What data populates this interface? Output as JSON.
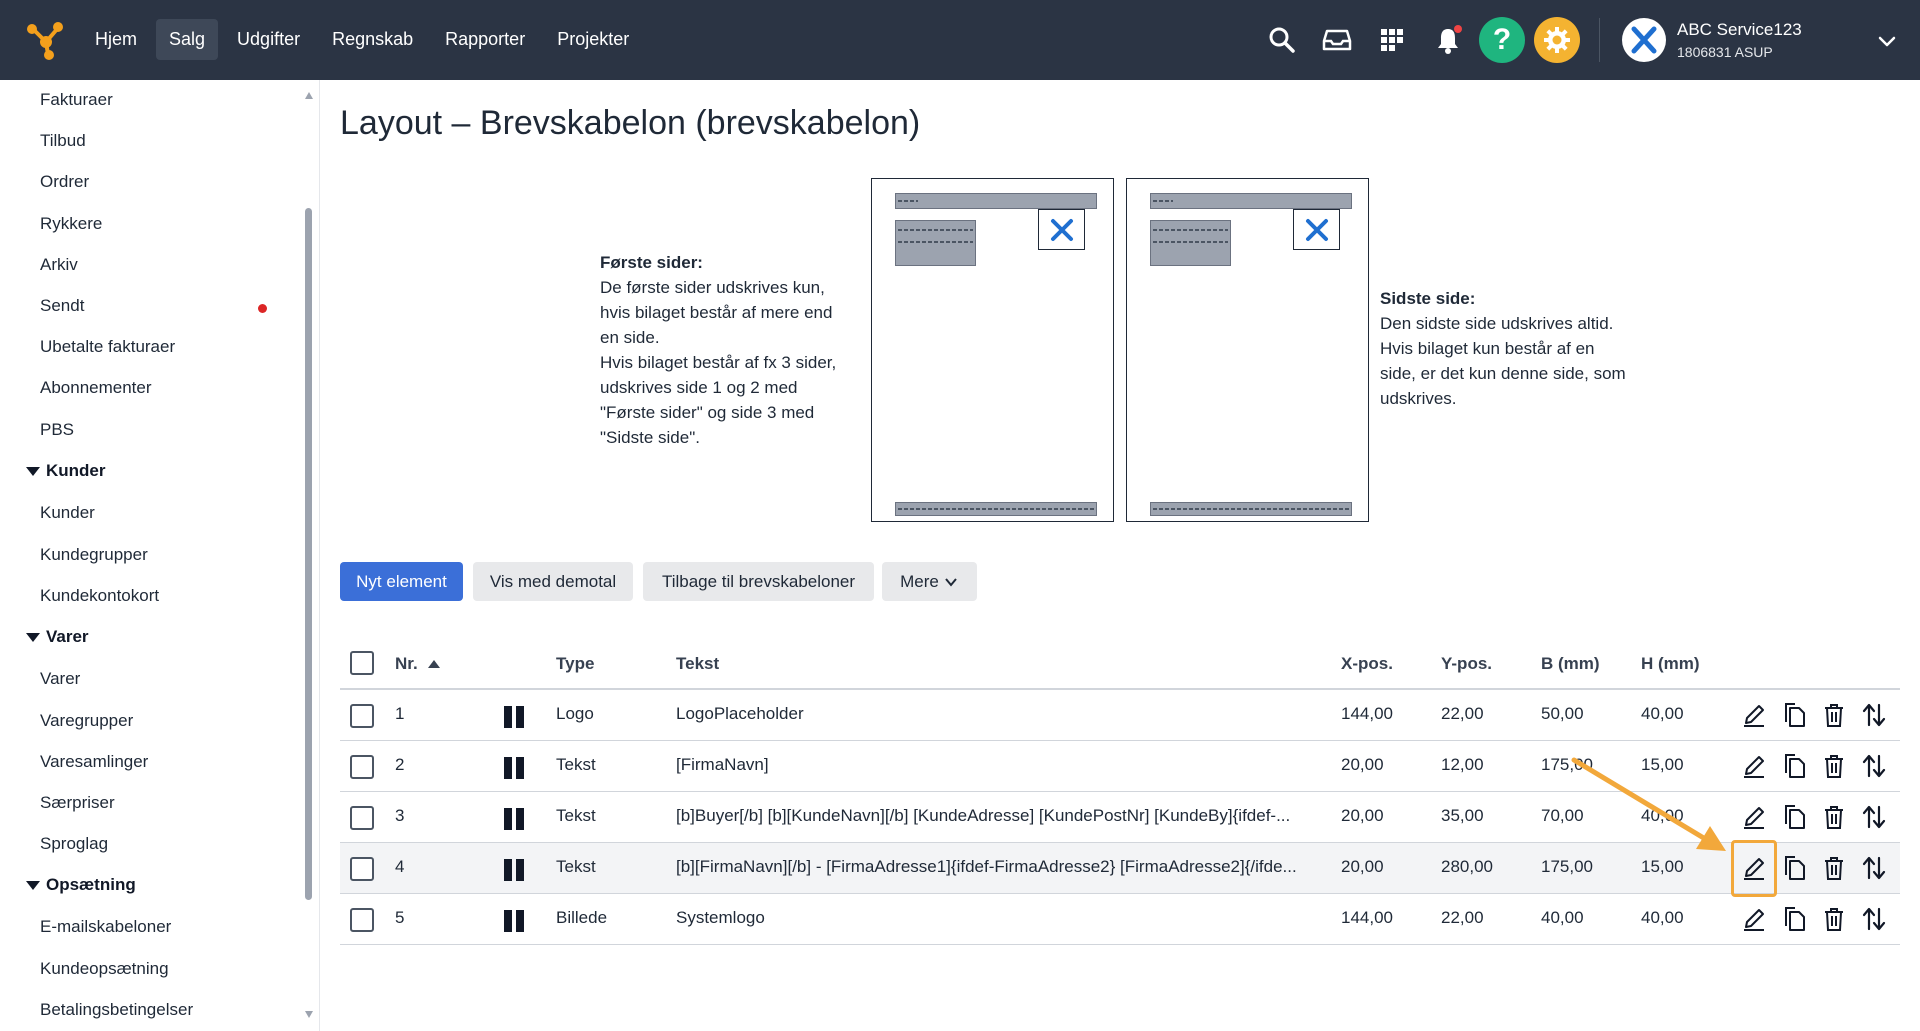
{
  "topbar": {
    "nav": [
      "Hjem",
      "Salg",
      "Udgifter",
      "Regnskab",
      "Rapporter",
      "Projekter"
    ],
    "active_nav": "Salg",
    "account": {
      "name": "ABC Service123",
      "sub": "1806831 ASUP"
    },
    "icons": [
      "search-icon",
      "inbox-icon",
      "apps-grid-icon",
      "bell-icon",
      "help-icon",
      "settings-gear-icon"
    ],
    "colors": {
      "bar": "#2b3444",
      "help": "#1fb57f",
      "settings": "#f4b331",
      "logo": "#f4a01c"
    }
  },
  "sidebar": {
    "items_top": [
      "Fakturaer",
      "Tilbud",
      "Ordrer",
      "Rykkere",
      "Arkiv",
      "Sendt",
      "Ubetalte fakturaer",
      "Abonnementer",
      "PBS"
    ],
    "sections": [
      {
        "label": "Kunder",
        "items": [
          "Kunder",
          "Kundegrupper",
          "Kundekontokort"
        ]
      },
      {
        "label": "Varer",
        "items": [
          "Varer",
          "Varegrupper",
          "Varesamlinger",
          "Særpriser",
          "Sproglag"
        ]
      },
      {
        "label": "Opsætning",
        "items": [
          "E-mailskabeloner",
          "Kundeopsætning",
          "Betalingsbetingelser"
        ]
      }
    ]
  },
  "main": {
    "title": "Layout – Brevskabelon (brevskabelon)",
    "first_pages": {
      "heading": "Første sider:",
      "lines": [
        "De første sider udskrives kun,",
        "hvis bilaget består af mere end",
        "en side.",
        "Hvis bilaget består af fx 3 sider,",
        "udskrives side 1 og 2 med",
        "\"Første sider\" og side 3 med",
        "\"Sidste side\"."
      ]
    },
    "last_page": {
      "heading": "Sidste side:",
      "lines": [
        "Den sidste side udskrives altid.",
        "Hvis bilaget kun består af en",
        "side, er det kun denne side, som",
        "udskrives."
      ]
    },
    "buttons": {
      "new": "Nyt element",
      "demo": "Vis med demotal",
      "back": "Tilbage til brevskabeloner",
      "more": "Mere"
    },
    "table": {
      "headers": {
        "nr": "Nr.",
        "type": "Type",
        "text": "Tekst",
        "x": "X-pos.",
        "y": "Y-pos.",
        "b": "B (mm)",
        "h": "H (mm)"
      },
      "sort": "ascending",
      "rows": [
        {
          "nr": "1",
          "type": "Logo",
          "text": "LogoPlaceholder",
          "x": "144,00",
          "y": "22,00",
          "b": "50,00",
          "h": "40,00"
        },
        {
          "nr": "2",
          "type": "Tekst",
          "text": "[FirmaNavn]",
          "x": "20,00",
          "y": "12,00",
          "b": "175,00",
          "h": "15,00"
        },
        {
          "nr": "3",
          "type": "Tekst",
          "text": "[b]Buyer[/b] [b][KundeNavn][/b] [KundeAdresse] [KundePostNr] [KundeBy]{ifdef-...",
          "x": "20,00",
          "y": "35,00",
          "b": "70,00",
          "h": "40,00"
        },
        {
          "nr": "4",
          "type": "Tekst",
          "text": "[b][FirmaNavn][/b] - [FirmaAdresse1]{ifdef-FirmaAdresse2} [FirmaAdresse2]{/ifde...",
          "x": "20,00",
          "y": "280,00",
          "b": "175,00",
          "h": "15,00"
        },
        {
          "nr": "5",
          "type": "Billede",
          "text": "Systemlogo",
          "x": "144,00",
          "y": "22,00",
          "b": "40,00",
          "h": "40,00"
        }
      ],
      "highlighted_row": 4
    }
  }
}
